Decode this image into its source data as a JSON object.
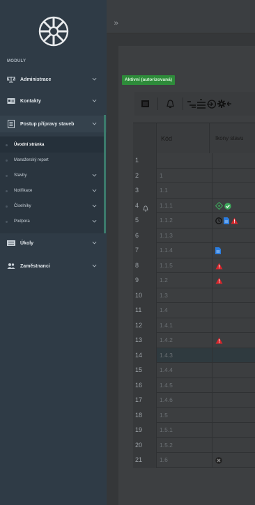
{
  "sidebar": {
    "section_title": "MODULY",
    "items": [
      {
        "label": "Administrace"
      },
      {
        "label": "Kontakty"
      },
      {
        "label": "Postup přípravy staveb"
      },
      {
        "label": "Úkoly"
      },
      {
        "label": "Zaměstnanci"
      }
    ],
    "subitems": [
      {
        "label": "Úvodní stránka"
      },
      {
        "label": "Manažerský report"
      },
      {
        "label": "Stavby"
      },
      {
        "label": "Notifikace"
      },
      {
        "label": "Číselníky"
      },
      {
        "label": "Podpora"
      }
    ]
  },
  "status_badge": "Aktivní (autorizovaná)",
  "table": {
    "columns": [
      "Kód",
      "Ikony stavu"
    ],
    "rows": [
      {
        "num": "1",
        "kod": "",
        "bell": false,
        "icons": []
      },
      {
        "num": "2",
        "kod": "1",
        "bell": false,
        "icons": []
      },
      {
        "num": "3",
        "kod": "1.1",
        "bell": false,
        "icons": []
      },
      {
        "num": "4",
        "kod": "1.1.1",
        "bell": true,
        "icons": [
          "diamond-icon",
          "check-circle-icon"
        ]
      },
      {
        "num": "5",
        "kod": "1.1.2",
        "bell": false,
        "icons": [
          "clock-icon",
          "document-icon",
          "warning-icon"
        ]
      },
      {
        "num": "6",
        "kod": "1.1.3",
        "bell": false,
        "icons": []
      },
      {
        "num": "7",
        "kod": "1.1.4",
        "bell": false,
        "icons": [
          "document-icon"
        ]
      },
      {
        "num": "8",
        "kod": "1.1.5",
        "bell": false,
        "icons": [
          "warning-icon"
        ]
      },
      {
        "num": "9",
        "kod": "1.2",
        "bell": false,
        "icons": [
          "warning-icon"
        ]
      },
      {
        "num": "10",
        "kod": "1.3",
        "bell": false,
        "icons": []
      },
      {
        "num": "11",
        "kod": "1.4",
        "bell": false,
        "icons": []
      },
      {
        "num": "12",
        "kod": "1.4.1",
        "bell": false,
        "icons": []
      },
      {
        "num": "13",
        "kod": "1.4.2",
        "bell": false,
        "icons": [
          "warning-icon"
        ]
      },
      {
        "num": "14",
        "kod": "1.4.3",
        "bell": false,
        "icons": [],
        "highlight": true
      },
      {
        "num": "15",
        "kod": "1.4.4",
        "bell": false,
        "icons": []
      },
      {
        "num": "16",
        "kod": "1.4.5",
        "bell": false,
        "icons": []
      },
      {
        "num": "17",
        "kod": "1.4.6",
        "bell": false,
        "icons": []
      },
      {
        "num": "18",
        "kod": "1.5",
        "bell": false,
        "icons": []
      },
      {
        "num": "19",
        "kod": "1.5.1",
        "bell": false,
        "icons": []
      },
      {
        "num": "20",
        "kod": "1.5.2",
        "bell": false,
        "icons": []
      },
      {
        "num": "21",
        "kod": "1.6",
        "bell": false,
        "icons": [
          "x-circle-icon"
        ]
      }
    ]
  },
  "colors": {
    "sidebar_bg": "#2f3b46",
    "badge_green": "#2e8b3a",
    "warning_red": "#d9262c",
    "doc_blue": "#2b7de0",
    "check_green": "#3ea95c"
  }
}
